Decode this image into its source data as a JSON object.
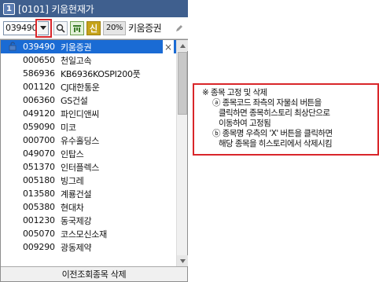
{
  "window": {
    "number": "1",
    "title": "[0101] 키움현재가"
  },
  "toolbar": {
    "code_value": "039490",
    "dropdown_icon": "chevron-down-icon",
    "search_icon": "search-icon",
    "chart_icon": "chart-icon",
    "badge_label": "신",
    "percent_label": "20%",
    "stock_name": "키움증권",
    "edit_icon": "pencil-icon"
  },
  "history": {
    "items": [
      {
        "code": "039490",
        "name": "키움증권",
        "selected": true
      },
      {
        "code": "000650",
        "name": "천일고속"
      },
      {
        "code": "586936",
        "name": "KB6936KOSPI200풋"
      },
      {
        "code": "001120",
        "name": "CJ대한통운"
      },
      {
        "code": "006360",
        "name": "GS건설"
      },
      {
        "code": "049120",
        "name": "파인디앤씨"
      },
      {
        "code": "059090",
        "name": "미코"
      },
      {
        "code": "000700",
        "name": "유수홀딩스"
      },
      {
        "code": "049070",
        "name": "인탑스"
      },
      {
        "code": "051370",
        "name": "인터플렉스"
      },
      {
        "code": "005180",
        "name": "빙그레"
      },
      {
        "code": "013580",
        "name": "계룡건설"
      },
      {
        "code": "005380",
        "name": "현대차"
      },
      {
        "code": "001230",
        "name": "동국제강"
      },
      {
        "code": "005070",
        "name": "코스모신소재"
      },
      {
        "code": "009290",
        "name": "광동제약"
      }
    ],
    "delete_symbol": "×",
    "footer_label": "이전조회종목 삭제"
  },
  "note": {
    "title": "※ 종목 고정 및 삭제",
    "a_line1": "ⓐ 종목코드 좌측의 자물쇠 버튼을",
    "a_line2": "클릭하면 종목히스토리 최상단으로",
    "a_line3": "이동하여 고정됨",
    "b_line1": "ⓑ 종목명 우측의 'X' 버튼을 클릭하면",
    "b_line2": "해당 종목을 히스토리에서 삭제시킴"
  },
  "colors": {
    "title_bar": "#3f5f8e",
    "selection": "#1a6bd4",
    "highlight_red": "#d9262a",
    "badge_gold": "#c6a31a"
  }
}
